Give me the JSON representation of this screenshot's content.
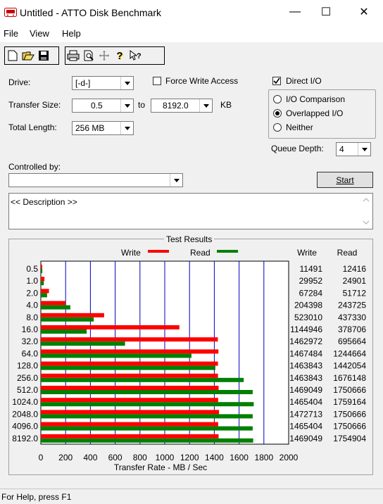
{
  "window": {
    "title": "Untitled - ATTO Disk Benchmark",
    "minimize": "—",
    "maximize": "☐",
    "close": "✕"
  },
  "menu": [
    "File",
    "View",
    "Help"
  ],
  "toolbar": {
    "icons": [
      "new-icon",
      "open-icon",
      "save-icon",
      "print-icon",
      "print-preview-icon",
      "move-icon",
      "help-icon",
      "context-help-icon"
    ]
  },
  "form": {
    "drive_label": "Drive:",
    "drive_value": "[-d-]",
    "force_write_label": "Force Write Access",
    "direct_io_label": "Direct I/O",
    "io_comparison_label": "I/O Comparison",
    "overlapped_io_label": "Overlapped I/O",
    "neither_label": "Neither",
    "transfer_size_label": "Transfer Size:",
    "transfer_from": "0.5",
    "to_label": "to",
    "transfer_to": "8192.0",
    "kb_label": "KB",
    "total_length_label": "Total Length:",
    "total_length_value": "256 MB",
    "queue_depth_label": "Queue Depth:",
    "queue_depth_value": "4",
    "controlled_by_label": "Controlled by:",
    "controlled_by_value": "",
    "start_label": "Start",
    "description": "<< Description >>"
  },
  "chart_data": {
    "type": "bar",
    "title": "Test Results",
    "xlabel": "Transfer Rate - MB / Sec",
    "xlim": [
      0,
      2000
    ],
    "xticks": [
      "0",
      "200",
      "400",
      "600",
      "800",
      "1000",
      "1200",
      "1400",
      "1600",
      "1800",
      "2000"
    ],
    "legend": [
      "Write",
      "Read"
    ],
    "col_write": "Write",
    "col_read": "Read",
    "colors": {
      "write": "#ff0000",
      "read": "#008000"
    },
    "categories": [
      "0.5",
      "1.0",
      "2.0",
      "4.0",
      "8.0",
      "16.0",
      "32.0",
      "64.0",
      "128.0",
      "256.0",
      "512.0",
      "1024.0",
      "2048.0",
      "4096.0",
      "8192.0"
    ],
    "series": [
      {
        "name": "Write",
        "values": [
          11.2,
          29.3,
          65.7,
          199.6,
          510.8,
          1118.1,
          1428.7,
          1433.1,
          1429.5,
          1429.5,
          1434.6,
          1431.1,
          1438.2,
          1431.1,
          1434.6
        ]
      },
      {
        "name": "Read",
        "values": [
          12.1,
          24.3,
          50.5,
          238.0,
          427.1,
          369.8,
          679.4,
          1215.5,
          1408.3,
          1636.9,
          1709.6,
          1718.0,
          1709.6,
          1709.6,
          1713.8
        ]
      }
    ],
    "write_text": [
      "11491",
      "29952",
      "67284",
      "204398",
      "523010",
      "1144946",
      "1462972",
      "1467484",
      "1463843",
      "1463843",
      "1469049",
      "1465404",
      "1472713",
      "1465404",
      "1469049"
    ],
    "read_text": [
      "12416",
      "24901",
      "51712",
      "243725",
      "437330",
      "378706",
      "695664",
      "1244664",
      "1442054",
      "1676148",
      "1750666",
      "1759164",
      "1750666",
      "1750666",
      "1754904"
    ]
  },
  "status": "For Help, press F1"
}
